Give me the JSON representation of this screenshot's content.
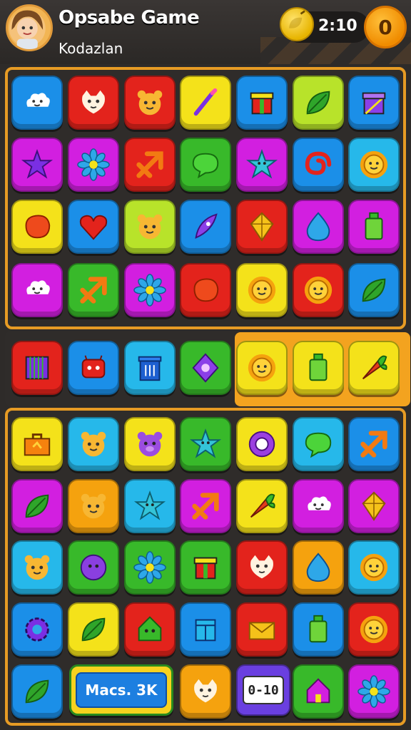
{
  "header": {
    "title": "Opsabe Game",
    "subtitle": "Kodazlan",
    "timer": "2:10",
    "coins": "0"
  },
  "colors": {
    "blue": "#1b8fe8",
    "red": "#e3231c",
    "yellow": "#f4e21a",
    "green": "#38b92a",
    "magenta": "#d21fe0",
    "cyan": "#26b8ea",
    "orange": "#f5a20e",
    "lime": "#b8e32a",
    "purple": "#7a2fe3",
    "frame": "#e79b24"
  },
  "board_top": [
    [
      [
        "blue",
        "cloud-face-icon"
      ],
      [
        "red",
        "cat-face-icon"
      ],
      [
        "red",
        "bear-face-icon"
      ],
      [
        "yellow",
        "magic-wand-icon"
      ],
      [
        "blue",
        "gift-box-icon"
      ],
      [
        "lime",
        "leaf-icon"
      ],
      [
        "blue",
        "purple-gift-icon"
      ]
    ],
    [
      [
        "magenta",
        "star-burst-icon"
      ],
      [
        "magenta",
        "flower-icon"
      ],
      [
        "red",
        "arrow-cross-icon"
      ],
      [
        "green",
        "speech-bubble-icon"
      ],
      [
        "magenta",
        "star-face-icon"
      ],
      [
        "blue",
        "swirl-icon"
      ],
      [
        "cyan",
        "sun-face-icon"
      ]
    ],
    [
      [
        "yellow",
        "blob-icon"
      ],
      [
        "blue",
        "heart-icon"
      ],
      [
        "lime",
        "bear-face-icon"
      ],
      [
        "blue",
        "feather-icon"
      ],
      [
        "red",
        "crystal-icon"
      ],
      [
        "magenta",
        "drop-icon"
      ],
      [
        "magenta",
        "bottle-icon"
      ]
    ],
    [
      [
        "magenta",
        "cloud-face-icon"
      ],
      [
        "green",
        "arrow-cross-icon"
      ],
      [
        "magenta",
        "flower-icon"
      ],
      [
        "red",
        "blob-icon"
      ],
      [
        "yellow",
        "sun-face-icon"
      ],
      [
        "red",
        "sun-face-icon"
      ],
      [
        "blue",
        "leaf-icon"
      ]
    ]
  ],
  "strip": [
    [
      "red",
      "cage-icon"
    ],
    [
      "blue",
      "robot-face-icon"
    ],
    [
      "cyan",
      "trash-can-icon"
    ],
    [
      "green",
      "gem-eye-icon"
    ],
    [
      "yellow",
      "sun-face-icon"
    ],
    [
      "yellow",
      "bottle-icon"
    ],
    [
      "yellow",
      "carrot-icon"
    ]
  ],
  "board_bottom": [
    [
      [
        "yellow",
        "toolbox-icon"
      ],
      [
        "cyan",
        "bear-face-icon"
      ],
      [
        "yellow",
        "pig-face-icon"
      ],
      [
        "green",
        "star-face-icon"
      ],
      [
        "yellow",
        "flower-ring-icon"
      ],
      [
        "cyan",
        "speech-bubble-icon"
      ],
      [
        "blue",
        "arrow-cross-icon"
      ]
    ],
    [
      [
        "magenta",
        "leaf-icon"
      ],
      [
        "orange",
        "bear-face-icon"
      ],
      [
        "cyan",
        "star-face-icon"
      ],
      [
        "magenta",
        "arrow-cross-icon"
      ],
      [
        "yellow",
        "carrot-icon"
      ],
      [
        "magenta",
        "cloud-face-icon"
      ],
      [
        "magenta",
        "crystal-icon"
      ]
    ],
    [
      [
        "cyan",
        "bear-face-icon"
      ],
      [
        "green",
        "blob-face-icon"
      ],
      [
        "green",
        "flower-icon"
      ],
      [
        "green",
        "gift-box-icon"
      ],
      [
        "red",
        "cat-face-icon"
      ],
      [
        "orange",
        "drop-icon"
      ],
      [
        "cyan",
        "sun-face-icon"
      ]
    ],
    [
      [
        "blue",
        "gear-icon"
      ],
      [
        "yellow",
        "leaf-icon"
      ],
      [
        "red",
        "house-face-icon"
      ],
      [
        "blue",
        "box-icon"
      ],
      [
        "red",
        "envelope-icon"
      ],
      [
        "blue",
        "bottle-icon"
      ],
      [
        "red",
        "sun-face-icon"
      ]
    ]
  ],
  "bottom_row": {
    "first_tile": [
      "blue",
      "leaf-icon"
    ],
    "score_label": "Macs. 3K",
    "third_tile": [
      "orange",
      "cat-face-icon"
    ],
    "counter_label": "0-10",
    "fifth_tile": [
      "green",
      "house-icon"
    ],
    "sixth_tile": [
      "magenta",
      "flower-icon"
    ]
  }
}
